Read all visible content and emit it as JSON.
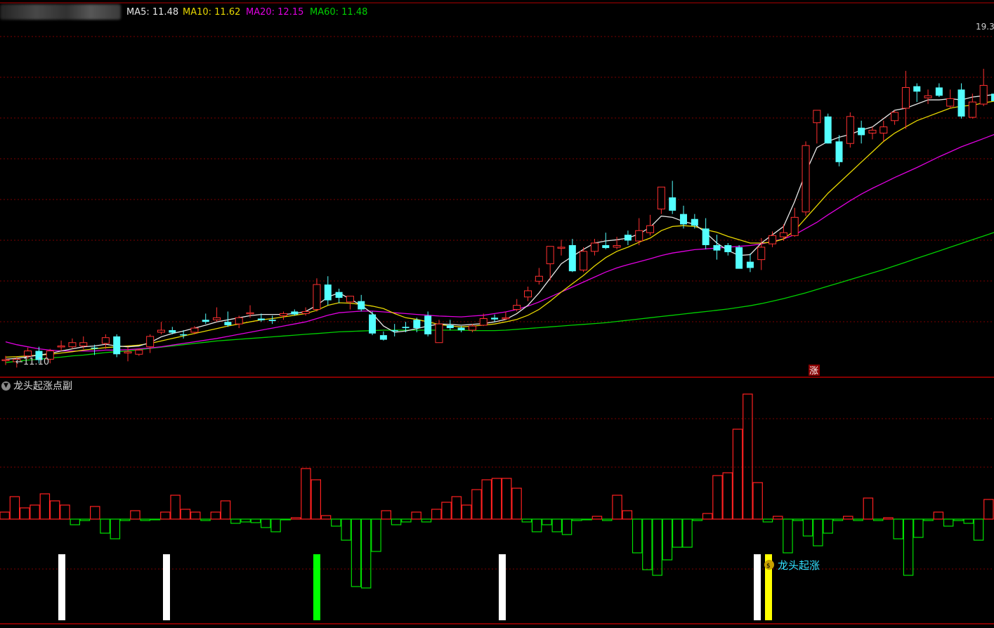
{
  "header": {
    "ma_legend": [
      {
        "label": "MA5: 11.48",
        "color": "#e6e6e6"
      },
      {
        "label": "MA10: 11.62",
        "color": "#e8d800"
      },
      {
        "label": "MA20: 12.15",
        "color": "#e000e0"
      },
      {
        "label": "MA60: 11.48",
        "color": "#00d000"
      }
    ]
  },
  "colors": {
    "up": "#ff3030",
    "down": "#54ffff",
    "grid": "#7a0000",
    "ma5": "#e6e6e6",
    "ma10": "#e8d800",
    "ma20": "#e000e0",
    "ma60": "#00d000",
    "hist_up": "#ff2020",
    "hist_down": "#00e000",
    "signal_white": "#ffffff",
    "signal_green": "#00ff00",
    "signal_yellow": "#ffff00",
    "signal_text": "#32e0ff"
  },
  "main_chart": {
    "price_top_label": "19.3",
    "low_marker_label": "←11.10",
    "zhang_badge": "涨"
  },
  "sub_chart": {
    "title": "龙头起涨点副",
    "collapse_icon": "chevron-down-icon",
    "signal_label": "龙头起涨",
    "signal_icon": "money-bag-icon"
  },
  "chart_data": [
    {
      "type": "candlestick",
      "ylim": [
        10.9,
        19.45
      ],
      "grid": true,
      "candles": [
        [
          11.29,
          11.38,
          11.16,
          11.29
        ],
        [
          11.24,
          11.35,
          11.1,
          11.3
        ],
        [
          11.38,
          11.58,
          11.3,
          11.5
        ],
        [
          11.5,
          11.6,
          11.2,
          11.28
        ],
        [
          11.3,
          11.55,
          11.2,
          11.5
        ],
        [
          11.62,
          11.75,
          11.5,
          11.62
        ],
        [
          11.6,
          11.8,
          11.55,
          11.7
        ],
        [
          11.62,
          11.85,
          11.55,
          11.7
        ],
        [
          11.58,
          11.65,
          11.4,
          11.56
        ],
        [
          11.68,
          11.9,
          11.55,
          11.82
        ],
        [
          11.85,
          11.9,
          11.35,
          11.42
        ],
        [
          11.45,
          11.6,
          11.25,
          11.48
        ],
        [
          11.42,
          11.55,
          11.38,
          11.52
        ],
        [
          11.6,
          11.9,
          11.45,
          11.85
        ],
        [
          11.95,
          12.2,
          11.9,
          12.0
        ],
        [
          12.0,
          12.08,
          11.9,
          11.94
        ],
        [
          11.9,
          12.0,
          11.8,
          11.88
        ],
        [
          11.95,
          12.1,
          11.9,
          12.05
        ],
        [
          12.25,
          12.4,
          12.15,
          12.2
        ],
        [
          12.25,
          12.55,
          12.2,
          12.3
        ],
        [
          12.2,
          12.45,
          12.08,
          12.12
        ],
        [
          12.15,
          12.35,
          12.05,
          12.3
        ],
        [
          12.4,
          12.6,
          12.3,
          12.42
        ],
        [
          12.28,
          12.4,
          12.2,
          12.24
        ],
        [
          12.25,
          12.35,
          12.15,
          12.22
        ],
        [
          12.35,
          12.45,
          12.25,
          12.4
        ],
        [
          12.45,
          12.5,
          12.35,
          12.38
        ],
        [
          12.4,
          12.55,
          12.35,
          12.45
        ],
        [
          12.5,
          13.25,
          12.45,
          13.1
        ],
        [
          13.1,
          13.3,
          12.6,
          12.72
        ],
        [
          12.92,
          13.0,
          12.65,
          12.78
        ],
        [
          12.68,
          12.82,
          12.5,
          12.82
        ],
        [
          12.7,
          12.85,
          12.45,
          12.5
        ],
        [
          12.38,
          12.45,
          11.88,
          11.92
        ],
        [
          11.88,
          11.97,
          11.75,
          11.77
        ],
        [
          12.0,
          12.15,
          11.85,
          11.98
        ],
        [
          12.08,
          12.2,
          11.95,
          12.05
        ],
        [
          12.25,
          12.3,
          11.95,
          12.05
        ],
        [
          12.35,
          12.45,
          11.85,
          11.9
        ],
        [
          11.7,
          12.25,
          11.7,
          12.15
        ],
        [
          12.12,
          12.25,
          12.0,
          12.05
        ],
        [
          12.06,
          12.1,
          11.95,
          12.0
        ],
        [
          12.0,
          12.15,
          11.95,
          12.1
        ],
        [
          12.12,
          12.4,
          12.1,
          12.28
        ],
        [
          12.3,
          12.38,
          12.2,
          12.26
        ],
        [
          12.3,
          12.45,
          12.25,
          12.3
        ],
        [
          12.5,
          12.75,
          12.45,
          12.6
        ],
        [
          12.8,
          13.05,
          12.7,
          12.95
        ],
        [
          13.18,
          13.5,
          13.1,
          13.3
        ],
        [
          13.6,
          14.0,
          13.2,
          14.02
        ],
        [
          14.0,
          14.18,
          13.8,
          14.0
        ],
        [
          14.05,
          14.2,
          13.4,
          13.42
        ],
        [
          13.45,
          14.0,
          13.4,
          13.9
        ],
        [
          13.9,
          14.2,
          13.8,
          14.1
        ],
        [
          14.05,
          14.35,
          13.95,
          13.98
        ],
        [
          14.0,
          14.25,
          13.95,
          14.04
        ],
        [
          14.3,
          14.4,
          14.05,
          14.16
        ],
        [
          14.15,
          14.7,
          14.05,
          14.4
        ],
        [
          14.35,
          14.78,
          14.28,
          14.52
        ],
        [
          14.92,
          15.15,
          14.8,
          15.45
        ],
        [
          15.2,
          15.6,
          14.8,
          14.88
        ],
        [
          14.8,
          15.0,
          14.45,
          14.55
        ],
        [
          14.68,
          14.8,
          14.45,
          14.52
        ],
        [
          14.45,
          14.7,
          13.95,
          14.05
        ],
        [
          14.05,
          14.3,
          13.7,
          13.92
        ],
        [
          14.05,
          14.1,
          13.8,
          13.88
        ],
        [
          14.0,
          14.05,
          13.6,
          13.48
        ],
        [
          13.65,
          13.85,
          13.4,
          13.5
        ],
        [
          13.7,
          14.22,
          13.45,
          14.0
        ],
        [
          14.08,
          14.38,
          14.0,
          14.28
        ],
        [
          14.25,
          14.55,
          14.15,
          14.35
        ],
        [
          14.28,
          14.95,
          14.25,
          14.72
        ],
        [
          14.85,
          16.55,
          14.75,
          16.45
        ],
        [
          17.0,
          17.3,
          16.5,
          17.3
        ],
        [
          17.15,
          17.22,
          16.5,
          16.5
        ],
        [
          16.55,
          16.7,
          15.95,
          16.05
        ],
        [
          16.5,
          17.25,
          16.4,
          17.15
        ],
        [
          16.88,
          17.05,
          16.5,
          16.7
        ],
        [
          16.75,
          16.9,
          16.6,
          16.82
        ],
        [
          16.75,
          17.05,
          16.55,
          16.9
        ],
        [
          17.05,
          17.3,
          16.95,
          17.25
        ],
        [
          17.35,
          18.25,
          16.85,
          17.85
        ],
        [
          17.88,
          17.95,
          17.5,
          17.75
        ],
        [
          17.6,
          17.8,
          17.45,
          17.65
        ],
        [
          17.85,
          17.95,
          17.62,
          17.65
        ],
        [
          17.4,
          17.8,
          17.35,
          17.58
        ],
        [
          17.8,
          17.95,
          17.1,
          17.15
        ],
        [
          17.13,
          17.7,
          17.1,
          17.5
        ],
        [
          17.45,
          18.3,
          17.4,
          17.9
        ],
        [
          17.7,
          17.9,
          17.55,
          17.52
        ],
        [
          17.6,
          17.7,
          17.35,
          17.45
        ],
        [
          17.58,
          17.8,
          17.5,
          17.75
        ],
        [
          17.85,
          17.95,
          17.55,
          17.62
        ],
        [
          17.3,
          17.95,
          17.3,
          17.82
        ],
        [
          17.58,
          17.88,
          17.18,
          17.58
        ],
        [
          18.05,
          18.1,
          17.4,
          17.9
        ]
      ],
      "ma5": [
        11.3,
        11.32,
        11.36,
        11.4,
        11.44,
        11.5,
        11.55,
        11.6,
        11.62,
        11.66,
        11.62,
        11.6,
        11.62,
        11.7,
        11.84,
        11.92,
        11.98,
        12.05,
        12.12,
        12.2,
        12.25,
        12.3,
        12.35,
        12.38,
        12.38,
        12.38,
        12.4,
        12.45,
        12.6,
        12.8,
        12.9,
        12.75,
        12.6,
        12.4,
        12.1,
        11.95,
        11.98,
        12.04,
        12.1,
        12.15,
        12.14,
        12.12,
        12.14,
        12.16,
        12.2,
        12.26,
        12.4,
        12.6,
        12.9,
        13.25,
        13.6,
        13.78,
        13.95,
        14.1,
        14.15,
        14.18,
        14.22,
        14.32,
        14.48,
        14.75,
        14.72,
        14.62,
        14.55,
        14.35,
        14.1,
        13.92,
        13.8,
        13.82,
        14.1,
        14.3,
        14.5,
        15.1,
        15.8,
        16.4,
        16.55,
        16.65,
        16.72,
        16.82,
        16.9,
        17.1,
        17.3,
        17.35,
        17.45,
        17.55,
        17.55,
        17.58,
        17.55,
        17.62,
        17.65,
        17.68,
        17.7,
        17.72,
        17.7,
        17.75,
        17.82
      ],
      "ma10": [
        11.35,
        11.36,
        11.38,
        11.4,
        11.42,
        11.45,
        11.48,
        11.52,
        11.55,
        11.58,
        11.6,
        11.62,
        11.64,
        11.68,
        11.74,
        11.8,
        11.86,
        11.92,
        11.98,
        12.04,
        12.1,
        12.15,
        12.2,
        12.25,
        12.28,
        12.32,
        12.36,
        12.4,
        12.48,
        12.6,
        12.66,
        12.65,
        12.62,
        12.58,
        12.52,
        12.4,
        12.3,
        12.26,
        12.2,
        12.14,
        12.1,
        12.08,
        12.1,
        12.12,
        12.15,
        12.2,
        12.26,
        12.36,
        12.5,
        12.7,
        12.92,
        13.12,
        13.32,
        13.55,
        13.75,
        13.9,
        14.0,
        14.12,
        14.22,
        14.4,
        14.5,
        14.52,
        14.5,
        14.42,
        14.36,
        14.26,
        14.18,
        14.1,
        14.1,
        14.12,
        14.2,
        14.4,
        14.7,
        15.0,
        15.3,
        15.55,
        15.8,
        16.05,
        16.3,
        16.55,
        16.75,
        16.9,
        17.05,
        17.15,
        17.25,
        17.35,
        17.4,
        17.42,
        17.48,
        17.52,
        17.55,
        17.6,
        17.62,
        17.65,
        17.7
      ],
      "ma20": [
        11.72,
        11.65,
        11.6,
        11.55,
        11.52,
        11.5,
        11.5,
        11.5,
        11.5,
        11.52,
        11.52,
        11.53,
        11.55,
        11.57,
        11.6,
        11.64,
        11.68,
        11.72,
        11.76,
        11.8,
        11.85,
        11.9,
        11.95,
        12.0,
        12.05,
        12.1,
        12.15,
        12.2,
        12.28,
        12.36,
        12.42,
        12.44,
        12.46,
        12.46,
        12.44,
        12.42,
        12.4,
        12.38,
        12.36,
        12.34,
        12.33,
        12.32,
        12.34,
        12.36,
        12.4,
        12.44,
        12.5,
        12.58,
        12.68,
        12.8,
        12.92,
        13.04,
        13.16,
        13.28,
        13.4,
        13.5,
        13.58,
        13.65,
        13.72,
        13.8,
        13.86,
        13.9,
        13.94,
        13.96,
        13.98,
        14.0,
        14.02,
        14.04,
        14.08,
        14.14,
        14.2,
        14.3,
        14.45,
        14.6,
        14.78,
        14.95,
        15.12,
        15.28,
        15.42,
        15.55,
        15.68,
        15.8,
        15.92,
        16.05,
        16.18,
        16.3,
        16.42,
        16.52,
        16.62,
        16.72,
        16.82,
        16.92,
        17.02,
        17.12,
        17.25
      ],
      "ma60": [
        11.22,
        11.25,
        11.28,
        11.3,
        11.33,
        11.35,
        11.38,
        11.4,
        11.43,
        11.46,
        11.48,
        11.5,
        11.53,
        11.56,
        11.59,
        11.62,
        11.65,
        11.68,
        11.71,
        11.74,
        11.76,
        11.78,
        11.8,
        11.82,
        11.84,
        11.86,
        11.88,
        11.9,
        11.92,
        11.94,
        11.96,
        11.97,
        11.98,
        11.99,
        12.0,
        12.0,
        12.0,
        12.0,
        12.0,
        12.0,
        12.0,
        12.0,
        11.99,
        11.99,
        11.99,
        12.0,
        12.02,
        12.04,
        12.06,
        12.08,
        12.1,
        12.12,
        12.14,
        12.16,
        12.18,
        12.21,
        12.24,
        12.27,
        12.3,
        12.33,
        12.36,
        12.39,
        12.42,
        12.45,
        12.48,
        12.51,
        12.55,
        12.59,
        12.64,
        12.7,
        12.76,
        12.83,
        12.9,
        12.98,
        13.06,
        13.14,
        13.22,
        13.3,
        13.38,
        13.46,
        13.55,
        13.64,
        13.73,
        13.82,
        13.91,
        14.0,
        14.09,
        14.18,
        14.27,
        14.36,
        14.45,
        14.54,
        14.63,
        14.72,
        14.82
      ]
    },
    {
      "type": "bar",
      "ylim": [
        -100,
        175
      ],
      "values": [
        10,
        32,
        16,
        20,
        36,
        26,
        20,
        -8,
        -2,
        18,
        -20,
        -28,
        -2,
        12,
        -2,
        -1,
        10,
        34,
        14,
        10,
        -2,
        10,
        26,
        -6,
        -4,
        -5,
        -12,
        -18,
        -1,
        2,
        72,
        56,
        5,
        -10,
        -30,
        -96,
        -98,
        -46,
        12,
        -8,
        -4,
        10,
        -4,
        14,
        24,
        32,
        20,
        42,
        56,
        58,
        58,
        44,
        -4,
        -18,
        -8,
        -18,
        -22,
        -2,
        -1,
        4,
        -2,
        34,
        12,
        -48,
        -72,
        -80,
        -58,
        -40,
        -40,
        -2,
        8,
        62,
        66,
        128,
        178,
        52,
        -4,
        4,
        -48,
        -2,
        -24,
        -38,
        -20,
        -2,
        4,
        -2,
        30,
        -2,
        2,
        -28,
        -80,
        -26,
        -2,
        10,
        -10,
        -2,
        -6,
        -30,
        28
      ]
    }
  ]
}
